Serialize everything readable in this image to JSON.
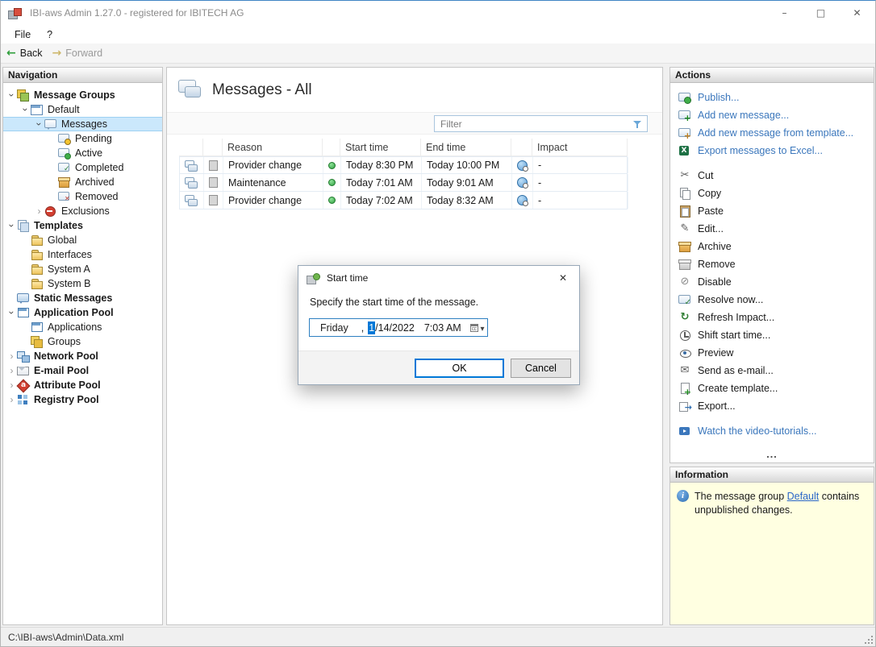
{
  "window": {
    "title": "IBI-aws Admin 1.27.0 - registered for IBITECH AG",
    "controls": {
      "minimize": "–",
      "maximize": "□",
      "close": "✕"
    }
  },
  "menubar": {
    "items": [
      "File",
      "?"
    ]
  },
  "toolbar": {
    "back": "Back",
    "forward": "Forward"
  },
  "navigation": {
    "header": "Navigation",
    "tree": [
      {
        "label": "Message Groups",
        "depth": 0,
        "icon": "message-groups",
        "expander": "down",
        "bold": true
      },
      {
        "label": "Default",
        "depth": 1,
        "icon": "default-group",
        "expander": "down"
      },
      {
        "label": "Messages",
        "depth": 2,
        "icon": "messages",
        "expander": "down",
        "selected": true
      },
      {
        "label": "Pending",
        "depth": 3,
        "icon": "pending"
      },
      {
        "label": "Active",
        "depth": 3,
        "icon": "active"
      },
      {
        "label": "Completed",
        "depth": 3,
        "icon": "completed"
      },
      {
        "label": "Archived",
        "depth": 3,
        "icon": "archived"
      },
      {
        "label": "Removed",
        "depth": 3,
        "icon": "removed"
      },
      {
        "label": "Exclusions",
        "depth": 2,
        "icon": "exclusions",
        "expander": "right"
      },
      {
        "label": "Templates",
        "depth": 0,
        "icon": "templates",
        "expander": "down",
        "bold": true
      },
      {
        "label": "Global",
        "depth": 1,
        "icon": "folder"
      },
      {
        "label": "Interfaces",
        "depth": 1,
        "icon": "folder"
      },
      {
        "label": "System A",
        "depth": 1,
        "icon": "folder"
      },
      {
        "label": "System B",
        "depth": 1,
        "icon": "folder"
      },
      {
        "label": "Static Messages",
        "depth": 0,
        "icon": "static-messages",
        "bold": true
      },
      {
        "label": "Application Pool",
        "depth": 0,
        "icon": "application-pool",
        "expander": "down",
        "bold": true
      },
      {
        "label": "Applications",
        "depth": 1,
        "icon": "applications"
      },
      {
        "label": "Groups",
        "depth": 1,
        "icon": "groups"
      },
      {
        "label": "Network Pool",
        "depth": 0,
        "icon": "network-pool",
        "expander": "right",
        "bold": true
      },
      {
        "label": "E-mail Pool",
        "depth": 0,
        "icon": "email-pool",
        "expander": "right",
        "bold": true
      },
      {
        "label": "Attribute Pool",
        "depth": 0,
        "icon": "attribute-pool",
        "expander": "right",
        "bold": true
      },
      {
        "label": "Registry Pool",
        "depth": 0,
        "icon": "registry-pool",
        "expander": "right",
        "bold": true
      }
    ]
  },
  "main": {
    "title": "Messages - All",
    "filter_placeholder": "Filter",
    "table": {
      "columns": [
        "Reason",
        "Start time",
        "End time",
        "Impact"
      ],
      "rows": [
        {
          "reason": "Provider change",
          "start_time": "Today 8:30 PM",
          "end_time": "Today 10:00 PM",
          "impact": "-"
        },
        {
          "reason": "Maintenance",
          "start_time": "Today 7:01 AM",
          "end_time": "Today 9:01 AM",
          "impact": "-"
        },
        {
          "reason": "Provider change",
          "start_time": "Today 7:02 AM",
          "end_time": "Today 8:32 AM",
          "impact": "-"
        }
      ]
    }
  },
  "dialog": {
    "title": "Start time",
    "close": "✕",
    "message": "Specify the start time of the message.",
    "datetime": {
      "day": "Friday",
      "comma": ",",
      "selected": "1",
      "date_rest": "/14/2022",
      "time": "7:03 AM"
    },
    "ok": "OK",
    "cancel": "Cancel"
  },
  "actions": {
    "header": "Actions",
    "primary": [
      {
        "label": "Publish...",
        "icon": "publish"
      },
      {
        "label": "Add new message...",
        "icon": "add-message"
      },
      {
        "label": "Add new message from template...",
        "icon": "add-message-template"
      },
      {
        "label": "Export messages to Excel...",
        "icon": "export-excel"
      }
    ],
    "secondary": [
      {
        "label": "Cut",
        "icon": "cut"
      },
      {
        "label": "Copy",
        "icon": "copy"
      },
      {
        "label": "Paste",
        "icon": "paste"
      },
      {
        "label": "Edit...",
        "icon": "edit"
      },
      {
        "label": "Archive",
        "icon": "archive"
      },
      {
        "label": "Remove",
        "icon": "remove"
      },
      {
        "label": "Disable",
        "icon": "disable"
      },
      {
        "label": "Resolve now...",
        "icon": "resolve"
      },
      {
        "label": "Refresh Impact...",
        "icon": "refresh"
      },
      {
        "label": "Shift start time...",
        "icon": "shift-time"
      },
      {
        "label": "Preview",
        "icon": "preview"
      },
      {
        "label": "Send as e-mail...",
        "icon": "send-email"
      },
      {
        "label": "Create template...",
        "icon": "create-template"
      },
      {
        "label": "Export...",
        "icon": "export"
      }
    ],
    "footer": [
      {
        "label": "Watch the video-tutorials...",
        "icon": "video"
      }
    ],
    "overflow": "..."
  },
  "information": {
    "header": "Information",
    "text_before": "The message group ",
    "link": "Default",
    "text_after": " contains unpublished changes."
  },
  "statusbar": {
    "path": "C:\\IBI-aws\\Admin\\Data.xml"
  },
  "colors": {
    "accent": "#0078d7",
    "link": "#3b77bc",
    "selection": "#cbe8fc",
    "info_background": "#ffffe1",
    "status_active": "#2f9e3f"
  }
}
